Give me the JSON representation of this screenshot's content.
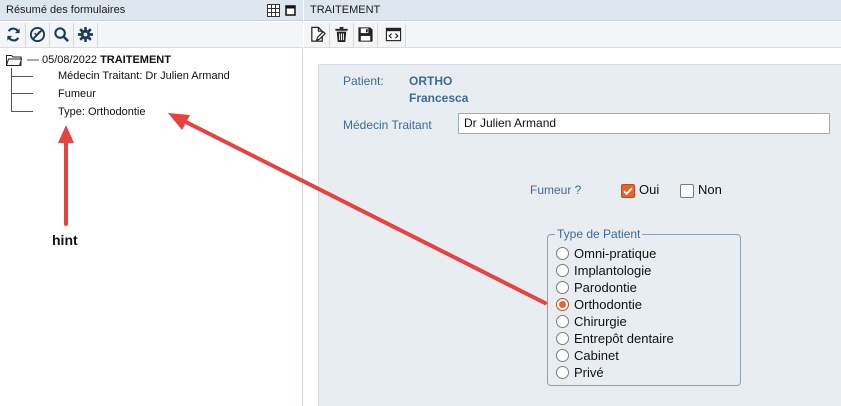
{
  "left_panel": {
    "title": "Résumé des formulaires",
    "header_icons": [
      "grid-icon",
      "restore-icon"
    ],
    "toolbar": [
      "refresh-icon",
      "no-filter-icon",
      "search-icon",
      "gear-icon"
    ],
    "tree": {
      "date": "05/08/2022",
      "root_label": "TRAITEMENT",
      "items": [
        "Médecin Traitant: Dr Julien Armand",
        "Fumeur",
        "Type: Orthodontie"
      ]
    }
  },
  "right_panel": {
    "title": "TRAITEMENT",
    "toolbar": [
      "edit-document-icon",
      "trash-icon",
      "save-icon",
      "code-icon"
    ],
    "form": {
      "patient_label": "Patient:",
      "patient_last_name": "ORTHO",
      "patient_first_name": "Francesca",
      "doctor_label": "Médecin Traitant",
      "doctor_value": "Dr Julien Armand",
      "smoker_label": "Fumeur ?",
      "smoker_yes": "Oui",
      "smoker_no": "Non",
      "smoker_value": "Oui",
      "patient_type_legend": "Type de Patient",
      "patient_types": [
        "Omni-pratique",
        "Implantologie",
        "Parodontie",
        "Orthodontie",
        "Chirurgie",
        "Entrepôt dentaire",
        "Cabinet",
        "Privé"
      ],
      "patient_type_selected": "Orthodontie"
    }
  },
  "annotation": {
    "hint_text": "hint",
    "arrow_color": "#e8423f"
  },
  "colors": {
    "header_bg": "#dde6ef",
    "form_bg": "#e8edf2",
    "label_blue": "#3e6a96",
    "accent_orange": "#e3652f"
  }
}
